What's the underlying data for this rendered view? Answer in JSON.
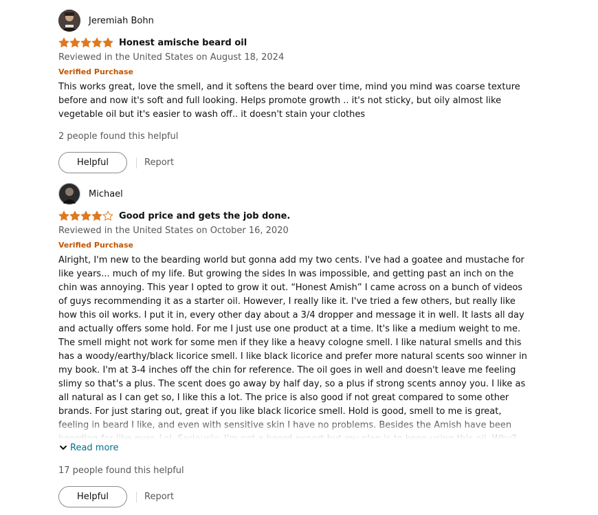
{
  "colors": {
    "star": "#de7921",
    "verified": "#c45500",
    "link": "#007185",
    "muted": "#565959"
  },
  "reviews": [
    {
      "author": "Jeremiah Bohn",
      "rating": 5,
      "title": "Honest amische beard oil",
      "meta": "Reviewed in the United States on August 18, 2024",
      "verified": "Verified Purchase",
      "body": "This works great, love the smell, and it softens the beard over time, mind you mind was coarse texture before and now it's soft and full looking. Helps promote growth .. it's not sticky, but oily almost like vegetable oil but it's easier to wash off.. it doesn't stain your clothes",
      "helpful_count": "2 people found this helpful",
      "helpful_label": "Helpful",
      "report_label": "Report"
    },
    {
      "author": "Michael",
      "rating": 4,
      "title": "Good price and gets the job done.",
      "meta": "Reviewed in the United States on October 16, 2020",
      "verified": "Verified Purchase",
      "body": "Alright, I'm new to the bearding world but gonna add my two cents. I've had a goatee and mustache for like years... much of my life. But growing the sides In was impossible, and getting past an inch on the chin was annoying. This year I opted to grow it out. “Honest Amish” I came across on a bunch of videos of guys recommending it as a starter oil. However, I really like it. I've tried a few others, but really like how this oil works. I put it in, every other day about a 3/4 dropper and message it in well. It lasts all day and actually offers some hold. For me I just use one product at a time. It's like a medium weight to me. The smell might not work for some men if they like a heavy cologne smell. I like natural smells and this has a woody/earthy/black licorice smell. I like black licorice and prefer more natural scents soo winner in my book. I'm at 3-4 inches off the chin for reference. The oil goes in well and doesn't leave me feeling slimy so that's a plus. The scent does go away by half day, so a plus if strong scents annoy you. I like as all natural as I can get so, I like this a lot. The price is also good if not great compared to some other brands. For just staring out, great if you like black licorice smell. Hold is good, smell to me is great, feeling in beard I like, and even with sensitive skin I have no problems. Besides the Amish have been bearding for like ever. Lol. Seriously, I'm not a beard expert but my plan is to keep using this oil. Why? Price, Availability, quantity,",
      "read_more": "Read more",
      "helpful_count": "17 people found this helpful",
      "helpful_label": "Helpful",
      "report_label": "Report"
    }
  ]
}
